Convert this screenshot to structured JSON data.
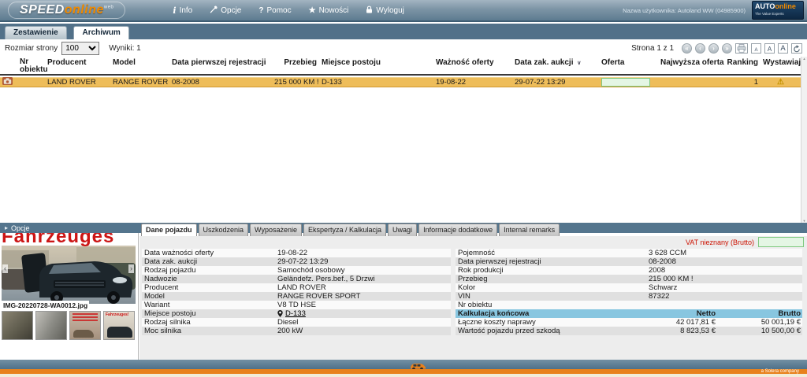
{
  "header": {
    "logo_speed": "SPEED",
    "logo_online": "online",
    "logo_sup": "web",
    "menu": [
      {
        "label": "Info",
        "glyph": "i"
      },
      {
        "label": "Opcje",
        "glyph": ""
      },
      {
        "label": "Pomoc",
        "glyph": "?"
      },
      {
        "label": "Nowości",
        "glyph": "★"
      },
      {
        "label": "Wyloguj",
        "glyph": ""
      }
    ],
    "username": "Nazwa użytkownika: Autoland WW (04985900)",
    "brand_auto": "AUTO",
    "brand_online": "online",
    "brand_tagline": "The Value Experts"
  },
  "main_tabs": [
    {
      "label": "Zestawienie"
    },
    {
      "label": "Archiwum"
    }
  ],
  "toolbar": {
    "page_size_label": "Rozmiar strony",
    "page_size_value": "100",
    "results": "Wyniki: 1",
    "page_indicator": "Strona 1 z 1",
    "pager_glyphs": [
      "«",
      "‹",
      "›",
      "»"
    ],
    "font_letter": "A"
  },
  "table": {
    "columns": [
      "Nr obiektu",
      "Producent",
      "Model",
      "Data pierwszej rejestracji",
      "Przebieg",
      "Miejsce postoju",
      "Ważność oferty",
      "Data zak. aukcji",
      "Oferta",
      "Najwyższa oferta",
      "Ranking",
      "Wystawiający"
    ],
    "sort_caret": "∨",
    "row": {
      "nr_obiektu": "",
      "producent": "LAND ROVER",
      "model": "RANGE ROVER SPOR...",
      "data_pierwszej_rejestracji": "08-2008",
      "przebieg": "215 000 KM !",
      "miejsce_postoju": "D-133",
      "waznosc_oferty": "19-08-22",
      "data_zak_aukcji": "29-07-22 13:29",
      "oferta": "",
      "najwyzsza_oferta": "",
      "ranking": "1",
      "warning_glyph": "⚠"
    }
  },
  "options": {
    "caret": "▸",
    "label": "Opcje"
  },
  "photo": {
    "overlay": "Fahrzeuges",
    "filename": "IMG-20220728-WA0012.jpg",
    "thumb_overlay": "Fahrzeuges!",
    "prev": "‹",
    "next": "›"
  },
  "details": {
    "tabs": [
      {
        "label": "Dane pojazdu"
      },
      {
        "label": "Uszkodzenia"
      },
      {
        "label": "Wyposażenie"
      },
      {
        "label": "Ekspertyza / Kalkulacja"
      },
      {
        "label": "Uwagi"
      },
      {
        "label": "Informacje dodatkowe"
      },
      {
        "label": "Internal remarks"
      }
    ],
    "vat_label": "VAT nieznany (Brutto)",
    "left": [
      {
        "label": "Data ważności oferty",
        "value": "19-08-22"
      },
      {
        "label": "Data zak. aukcji",
        "value": "29-07-22 13:29"
      },
      {
        "label": "Rodzaj pojazdu",
        "value": "Samochód osobowy"
      },
      {
        "label": "Nadwozie",
        "value": "Geländefz. Pers.bef., 5 Drzwi"
      },
      {
        "label": "Producent",
        "value": "LAND ROVER"
      },
      {
        "label": "Model",
        "value": "RANGE ROVER SPORT"
      },
      {
        "label": "Wariant",
        "value": "V8 TD HSE"
      },
      {
        "label": "Miejsce postoju",
        "value": "D-133"
      },
      {
        "label": "Rodzaj silnika",
        "value": "Diesel"
      },
      {
        "label": "Moc silnika",
        "value": "200 kW"
      }
    ],
    "right": [
      {
        "label": "Pojemność",
        "value": "3 628 CCM"
      },
      {
        "label": "Data pierwszej rejestracji",
        "value": "08-2008"
      },
      {
        "label": "Rok produkcji",
        "value": "2008"
      },
      {
        "label": "Przebieg",
        "value": "215 000 KM !"
      },
      {
        "label": "Kolor",
        "value": "Schwarz"
      },
      {
        "label": "VIN",
        "value": "87322"
      },
      {
        "label": "Nr obiektu",
        "value": ""
      }
    ],
    "calc": {
      "title": "Kalkulacja końcowa",
      "netto_label": "Netto",
      "brutto_label": "Brutto",
      "rows": [
        {
          "label": "Łączne koszty naprawy",
          "netto": "42 017,81 €",
          "brutto": "50 001,19 €"
        },
        {
          "label": "Wartość pojazdu przed szkodą",
          "netto": "8 823,53 €",
          "brutto": "10 500,00 €"
        }
      ]
    }
  },
  "footer": {
    "company": "a Solera company"
  },
  "colors": {
    "accent_orange": "#e8811c",
    "row_highlight": "#eebd5a",
    "calc_header_blue": "#88c6e0",
    "vat_red": "#cc1100",
    "green_input_border": "#7fc97f",
    "slate": "#54758d"
  }
}
